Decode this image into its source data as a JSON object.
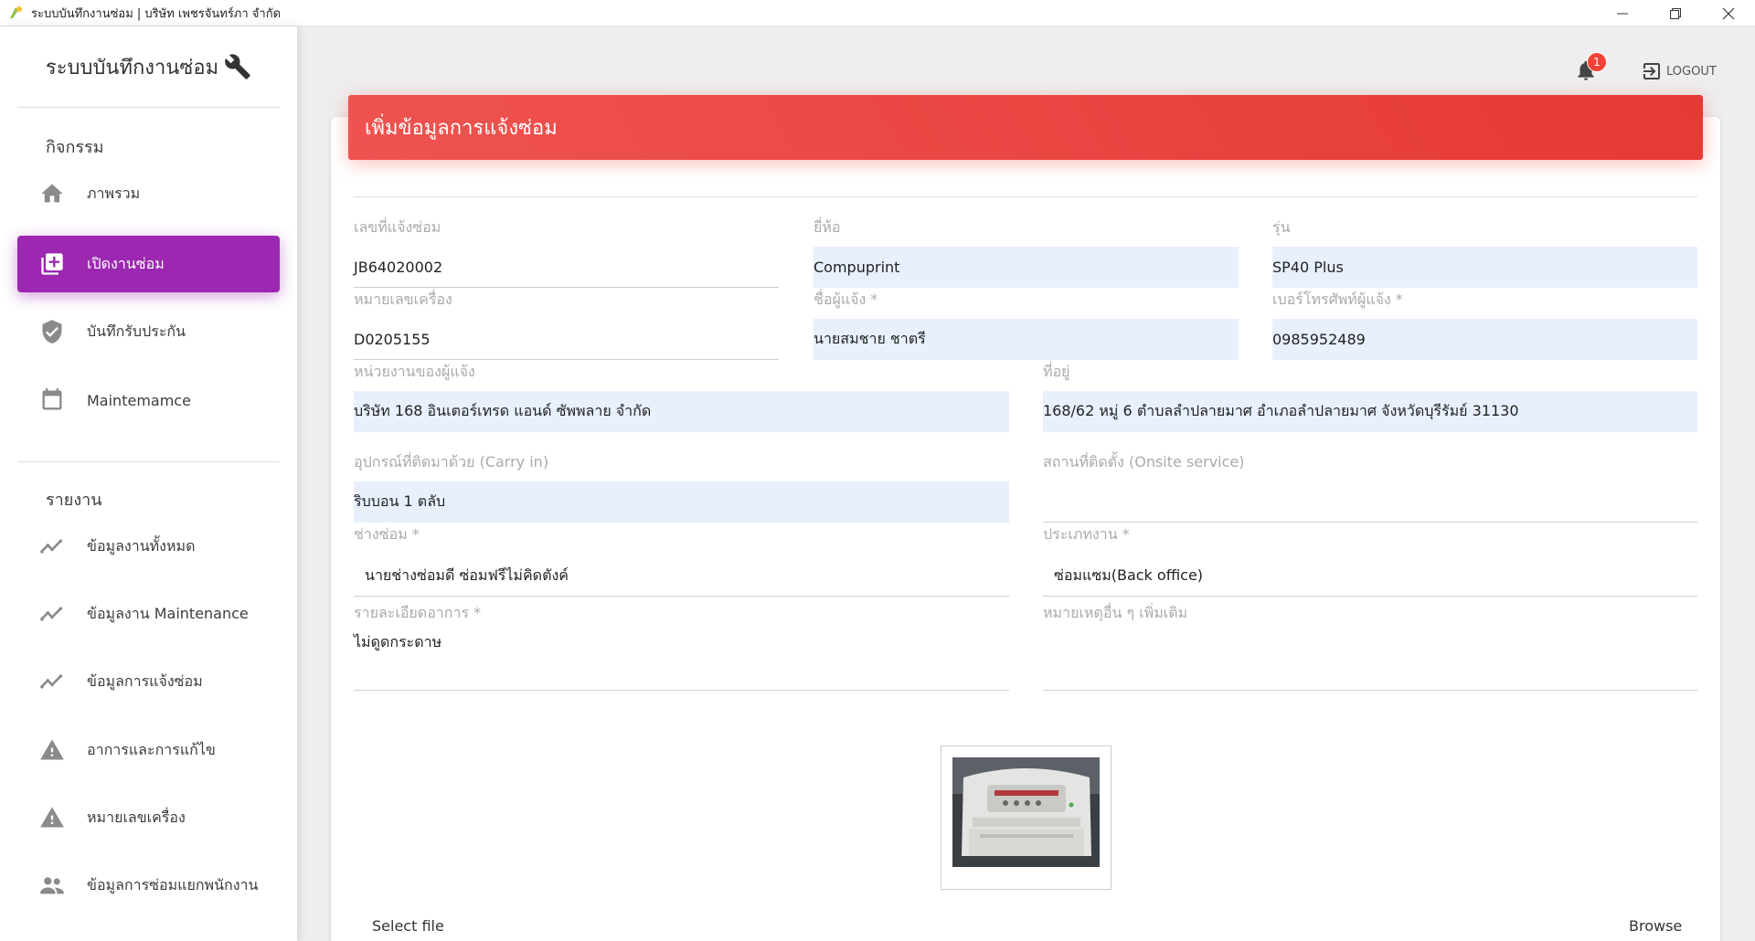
{
  "window": {
    "title": "ระบบบันทึกงานซ่อม | บริษัท เพชรจันทร์ภา จำกัด"
  },
  "sidebar": {
    "brand": "ระบบบันทึกงานซ่อม",
    "section_activities": "กิจกรรม",
    "section_reports": "รายงาน",
    "items": [
      {
        "label": "ภาพรวม",
        "icon": "home-icon"
      },
      {
        "label": "เปิดงานซ่อม",
        "icon": "library-add-icon",
        "active": true
      },
      {
        "label": "บันทึกรับประกัน",
        "icon": "shield-check-icon"
      },
      {
        "label": "Maintemamce",
        "icon": "calendar-icon"
      },
      {
        "label": "ข้อมูลงานทั้งหมด",
        "icon": "trending-icon"
      },
      {
        "label": "ข้อมูลงาน Maintenance",
        "icon": "trending-icon"
      },
      {
        "label": "ข้อมูลการแจ้งซ่อม",
        "icon": "trending-icon"
      },
      {
        "label": "อาการและการแก้ไข",
        "icon": "warning-icon"
      },
      {
        "label": "หมายเลขเครื่อง",
        "icon": "warning-icon"
      },
      {
        "label": "ข้อมูลการซ่อมแยกพนักงาน",
        "icon": "people-icon"
      }
    ]
  },
  "topbar": {
    "notification_count": "1",
    "logout_label": "LOGOUT"
  },
  "form": {
    "header": "เพิ่มข้อมูลการแจ้งซ่อม",
    "job_no": {
      "label": "เลขที่แจ้งซ่อม",
      "value": "JB64020002"
    },
    "brand": {
      "label": "ยี่ห้อ",
      "value": "Compuprint"
    },
    "model": {
      "label": "รุ่น",
      "value": "SP40 Plus"
    },
    "serial": {
      "label": "หมายเลขเครื่อง",
      "value": "D0205155"
    },
    "reporter": {
      "label": "ชื่อผู้แจ้ง *",
      "value": "นายสมชาย ชาตรี"
    },
    "phone": {
      "label": "เบอร์โทรศัพท์ผู้แจ้ง *",
      "value": "0985952489"
    },
    "agency": {
      "label": "หน่วยงานของผู้แจ้ง",
      "value": "บริษัท 168 อินเตอร์เทรด แอนด์ ซัพพลาย จำกัด"
    },
    "address": {
      "label": "ที่อยู่",
      "value": "168/62 หมู่ 6  ตำบลลำปลายมาศ อำเภอลำปลายมาศ  จังหวัดบุรีรัมย์ 31130"
    },
    "carry_in": {
      "label": "อุปกรณ์ที่ติดมาด้วย (Carry in)",
      "value": "ริบบอน 1 ตลับ"
    },
    "onsite": {
      "label": "สถานที่ติดตั้ง (Onsite service)",
      "value": ""
    },
    "technician": {
      "label": "ช่างซ่อม *",
      "value": "นายช่างซ่อมดี ซ่อมฟรีไม่คิดตังค์"
    },
    "job_type": {
      "label": "ประเภทงาน *",
      "value": "ซ่อมแซม(Back office)"
    },
    "symptom": {
      "label": "รายละเอียดอาการ *",
      "value": "ไม่ดูดกระดาษ"
    },
    "remarks": {
      "label": "หมายเหตุอื่น ๆ เพิ่มเติม",
      "value": ""
    },
    "select_file": "Select file",
    "browse": "Browse"
  },
  "colors": {
    "accent_purple": "#9c27b0",
    "header_red": "#e53935",
    "filled_field": "#e8f0fe"
  }
}
